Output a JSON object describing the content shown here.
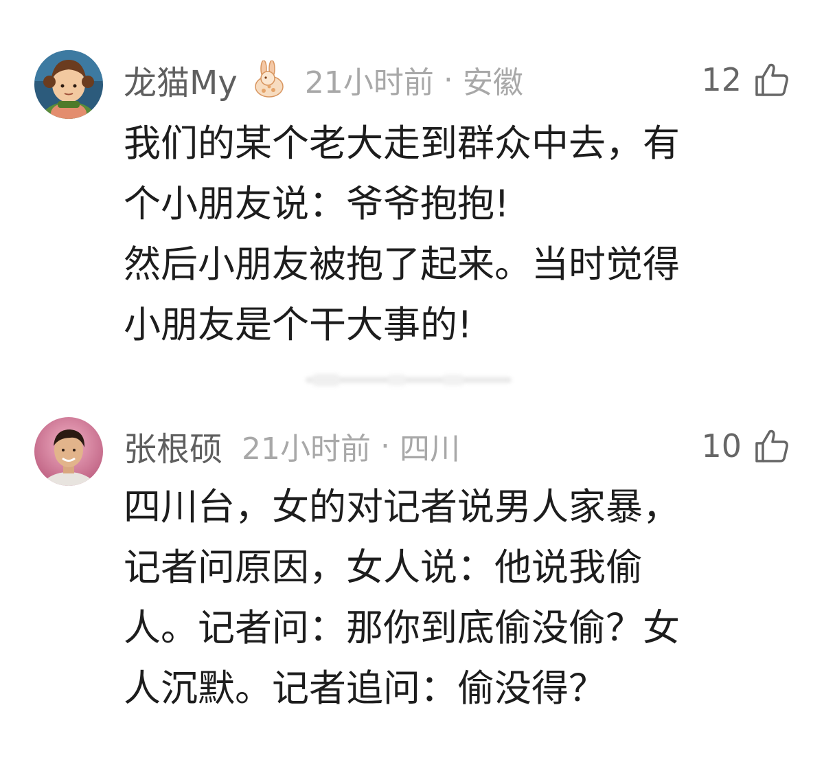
{
  "comments": [
    {
      "username": "龙猫My",
      "badge": "rabbit-icon",
      "time": "21小时前",
      "location": "安徽",
      "likes": "12",
      "lines": [
        "我们的某个老大走到群众中去，有",
        "个小朋友说：爷爷抱抱!",
        "然后小朋友被抱了起来。当时觉得",
        "小朋友是个干大事的!"
      ]
    },
    {
      "username": "张根硕",
      "time": "21小时前",
      "location": "四川",
      "likes": "10",
      "lines": [
        "四川台，女的对记者说男人家暴，",
        "记者问原因，女人说：他说我偷",
        "人。记者问：那你到底偷没偷？女",
        "人沉默。记者追问：偷没得？"
      ]
    }
  ],
  "colors": {
    "username": "#5f5f5f",
    "meta": "#a8a8a8",
    "body_text": "#1d1d1d",
    "like_icon": "#666666"
  }
}
